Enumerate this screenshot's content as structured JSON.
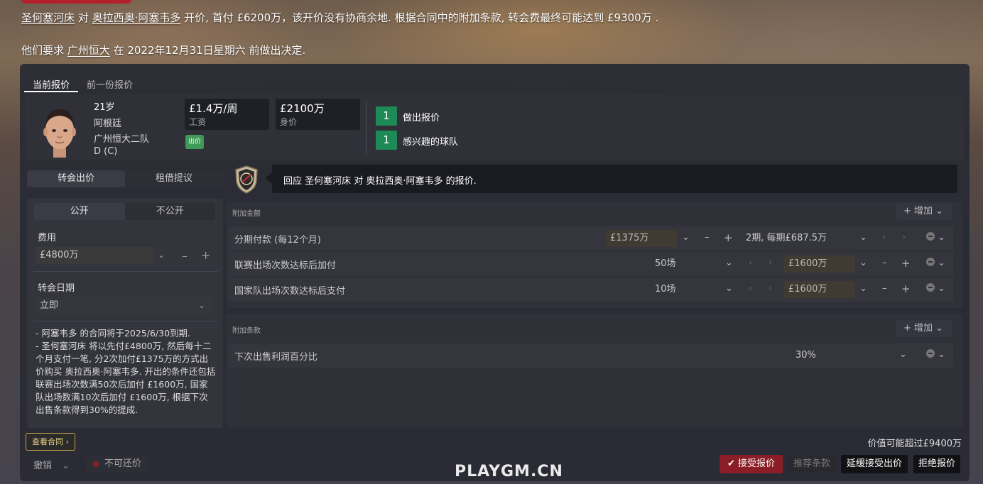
{
  "header": {
    "line1": {
      "club": "圣何塞河床",
      "vs": " 对 ",
      "player": "奥拉西奥·阿塞韦多",
      "rest": " 开价, 首付 £6200万，该开价没有协商余地. 根据合同中的附加条款, 转会费最终可能达到 £9300万 ."
    },
    "line2": {
      "pre": "他们要求 ",
      "club": "广州恒大",
      "rest": " 在 2022年12月31日星期六 前做出决定."
    }
  },
  "tabs": [
    "当前报价",
    "前一份报价"
  ],
  "player": {
    "age": "21岁",
    "nation": "阿根廷",
    "team": "广州恒大二队",
    "position": "D (C)",
    "wage_value": "£1.4万/周",
    "wage_label": "工资",
    "value_value": "£2100万",
    "value_label": "身价",
    "offer_badge": "出价",
    "offers_count": "1",
    "offers_label": "做出报价",
    "interested_count": "1",
    "interested_label": "感兴趣的球队"
  },
  "offer_type": {
    "transfer": "转会出价",
    "loan": "租借提议"
  },
  "message": "回应 圣何塞河床 对 奥拉西奥·阿塞韦多 的报价.",
  "left": {
    "public": "公开",
    "private": "不公开",
    "fee_label": "费用",
    "fee_value": "£4800万",
    "date_label": "转会日期",
    "date_value": "立即",
    "summary": [
      "- 阿塞韦多 的合同将于2025/6/30到期.",
      "- 圣何塞河床 将以先付£4800万, 然后每十二个月支付一笔, 分2次加付£1375万的方式出价购买 奥拉西奥·阿塞韦多. 开出的条件还包括 联赛出场次数满50次后加付 £1600万, 国家队出场数满10次后加付 £1600万, 根据下次出售条款得到30%的提成."
    ]
  },
  "add_fees": {
    "title": "附加金额",
    "add_label": "增加",
    "rows": [
      {
        "label": "分期付款 (每12个月)",
        "amount": "£1375万",
        "schedule": "2期, 每期£687.5万"
      },
      {
        "label": "联赛出场次数达标后加付",
        "count": "50场",
        "amount": "£1600万"
      },
      {
        "label": "国家队出场次数达标后支付",
        "count": "10场",
        "amount": "£1600万"
      }
    ]
  },
  "add_clauses": {
    "title": "附加条款",
    "add_label": "增加",
    "rows": [
      {
        "label": "下次出售利润百分比",
        "value": "30%"
      }
    ]
  },
  "footer": {
    "contract_btn": "查看合同",
    "value_note": "价值可能超过£9400万",
    "undo": "撤销",
    "no_counter": "不可还价",
    "accept": "接受报价",
    "suggest": "推荐条款",
    "delay": "延缓接受出价",
    "reject": "拒绝报价"
  },
  "watermark": "PLAYGM.CN",
  "colors": {
    "accent_green": "#1e8a55",
    "accept_red": "#8a1d25",
    "contract_gold": "#c9a24a"
  }
}
